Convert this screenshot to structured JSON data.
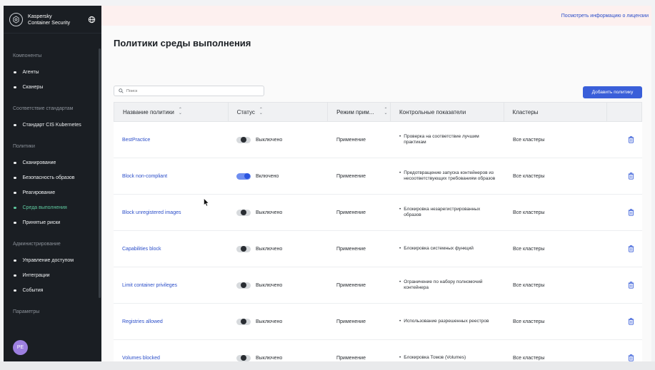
{
  "brand": {
    "line1": "Kaspersky",
    "line2": "Container Security"
  },
  "banner": {
    "link": "Посмотреть информацию о лицензии"
  },
  "sidebar": {
    "sections": [
      {
        "title": "Компоненты",
        "items": [
          {
            "label": "Агенты"
          },
          {
            "label": "Сканеры"
          }
        ]
      },
      {
        "title": "Соответствие стандартам",
        "items": [
          {
            "label": "Стандарт CIS Kubernetes"
          }
        ]
      },
      {
        "title": "Политики",
        "items": [
          {
            "label": "Сканирование"
          },
          {
            "label": "Безопасность образов"
          },
          {
            "label": "Реагирование"
          },
          {
            "label": "Среда выполнения",
            "active": true
          },
          {
            "label": "Принятые риски"
          }
        ]
      },
      {
        "title": "Администрирование",
        "items": [
          {
            "label": "Управление доступом"
          },
          {
            "label": "Интеграции"
          },
          {
            "label": "События"
          }
        ]
      },
      {
        "title": "Параметры",
        "items": []
      }
    ],
    "avatar": "PE"
  },
  "page": {
    "title": "Политики среды выполнения",
    "search_placeholder": "Поиск",
    "add_button": "Добавить политику"
  },
  "table": {
    "columns": [
      "Название политики",
      "Статус",
      "Режим прим...",
      "Контрольные показатели",
      "Кластеры",
      ""
    ],
    "rows": [
      {
        "name": "BestPractice",
        "enabled": false,
        "status": "Выключено",
        "mode": "Применение",
        "indicator": "Проверка на соответствие лучшим практикам",
        "clusters": "Все кластеры"
      },
      {
        "name": "Block non-compliant",
        "enabled": true,
        "status": "Включено",
        "mode": "Применение",
        "indicator": "Предотвращение запуска контейнеров из несоответствующих требованиям образов",
        "clusters": "Все кластеры"
      },
      {
        "name": "Block unregistered images",
        "enabled": false,
        "status": "Выключено",
        "mode": "Применение",
        "indicator": "Блокировка незарегистрированных образов",
        "clusters": "Все кластеры"
      },
      {
        "name": "Capabilities block",
        "enabled": false,
        "status": "Выключено",
        "mode": "Применение",
        "indicator": "Блокировка системных функций",
        "clusters": "Все кластеры"
      },
      {
        "name": "Limit container privileges",
        "enabled": false,
        "status": "Выключено",
        "mode": "Применение",
        "indicator": "Ограничение по набору полномочий контейнера",
        "clusters": "Все кластеры"
      },
      {
        "name": "Registries allowed",
        "enabled": false,
        "status": "Выключено",
        "mode": "Применение",
        "indicator": "Использование разрешенных реестров",
        "clusters": "Все кластеры"
      },
      {
        "name": "Volumes blocked",
        "enabled": false,
        "status": "Выключено",
        "mode": "Применение",
        "indicator": "Блокировка Томов (Volumes)",
        "clusters": "Все кластеры"
      }
    ]
  },
  "colors": {
    "accent": "#3a5fd9",
    "active_nav": "#5ec99f",
    "sidebar_bg": "#1a1e23",
    "banner_bg": "#fdf0ef"
  }
}
